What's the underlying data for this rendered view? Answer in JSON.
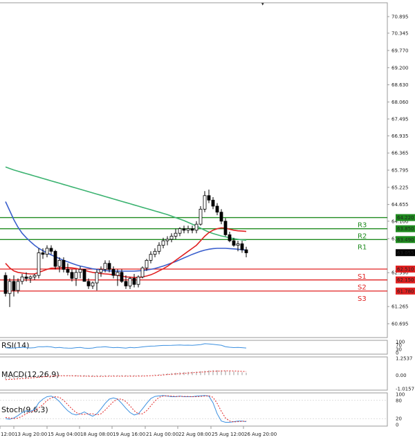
{
  "colors": {
    "background": "#ffffff",
    "panel_border": "#9a9a9a",
    "axis_text": "#222222",
    "bull_candle": "#ffffff",
    "bear_candle": "#000000",
    "ma_short": "#e02020",
    "ma_mid": "#3a5fcd",
    "ma_long": "#3cb371",
    "resistance": "#1e8a1e",
    "support": "#e02020",
    "price_tag": "#000000",
    "indicator_line": "#3a8fe0",
    "macd_signal": "#e02020",
    "macd_hist": "#9a9a9a",
    "stoch_signal": "#e02020"
  },
  "price_axis": {
    "ticks": [
      "70.895",
      "70.345",
      "69.770",
      "69.200",
      "68.630",
      "68.060",
      "67.495",
      "66.935",
      "66.365",
      "65.795",
      "65.225",
      "64.655",
      "64.100",
      "63.520",
      "62.390",
      "61.265",
      "60.695"
    ],
    "scale_min": 60.695,
    "scale_max": 70.895
  },
  "time_axis": {
    "labels": [
      "12:00",
      "13 Aug 20:00",
      "15 Aug 04:00",
      "18 Aug 08:00",
      "19 Aug 16:00",
      "21 Aug 00:00",
      "22 Aug 08:00",
      "25 Aug 12:00",
      "26 Aug 20:00"
    ]
  },
  "levels": [
    {
      "name": "R3",
      "tag": "64.220",
      "value": 64.22,
      "kind": "resistance"
    },
    {
      "name": "R2",
      "tag": "63.850",
      "value": 63.85,
      "kind": "resistance"
    },
    {
      "name": "R1",
      "tag": "63.490",
      "value": 63.49,
      "kind": "resistance"
    },
    {
      "name": "S1",
      "tag": "62.510",
      "value": 62.51,
      "kind": "support"
    },
    {
      "name": "S2",
      "tag": "62.150",
      "value": 62.15,
      "kind": "support"
    },
    {
      "name": "S3",
      "tag": "61.780",
      "value": 61.78,
      "kind": "support"
    }
  ],
  "current_price": {
    "tag": "63.055",
    "value": 63.055
  },
  "chart_data": {
    "type": "candlestick",
    "ylim": [
      60.695,
      70.895
    ],
    "candles": [
      [
        62.3,
        62.4,
        61.6,
        61.7
      ],
      [
        61.7,
        62.2,
        61.25,
        62.1
      ],
      [
        62.1,
        62.3,
        61.6,
        61.8
      ],
      [
        61.8,
        62.2,
        61.7,
        62.1
      ],
      [
        62.1,
        62.35,
        62.0,
        62.25
      ],
      [
        62.25,
        62.4,
        62.1,
        62.2
      ],
      [
        62.2,
        62.3,
        62.05,
        62.25
      ],
      [
        62.25,
        62.35,
        62.15,
        62.3
      ],
      [
        62.3,
        63.2,
        62.2,
        63.05
      ],
      [
        63.05,
        63.2,
        62.85,
        63.0
      ],
      [
        63.0,
        63.3,
        62.9,
        63.2
      ],
      [
        63.2,
        63.3,
        63.0,
        63.1
      ],
      [
        63.1,
        63.15,
        62.5,
        62.6
      ],
      [
        62.6,
        62.9,
        62.4,
        62.8
      ],
      [
        62.8,
        62.9,
        62.4,
        62.5
      ],
      [
        62.5,
        62.7,
        62.3,
        62.4
      ],
      [
        62.4,
        62.5,
        62.1,
        62.2
      ],
      [
        62.2,
        62.5,
        61.95,
        62.4
      ],
      [
        62.4,
        62.6,
        62.2,
        62.5
      ],
      [
        62.5,
        62.5,
        62.1,
        62.1
      ],
      [
        62.1,
        62.2,
        61.85,
        61.95
      ],
      [
        61.95,
        62.1,
        61.85,
        62.05
      ],
      [
        62.05,
        62.5,
        61.8,
        62.4
      ],
      [
        62.4,
        62.6,
        62.25,
        62.5
      ],
      [
        62.5,
        62.8,
        62.4,
        62.7
      ],
      [
        62.7,
        62.8,
        62.4,
        62.5
      ],
      [
        62.5,
        62.6,
        62.2,
        62.3
      ],
      [
        62.3,
        62.5,
        61.95,
        62.4
      ],
      [
        62.4,
        62.5,
        62.05,
        62.1
      ],
      [
        62.1,
        62.3,
        61.85,
        61.95
      ],
      [
        61.95,
        62.25,
        61.85,
        62.2
      ],
      [
        62.2,
        62.35,
        61.9,
        62.0
      ],
      [
        62.0,
        62.3,
        61.9,
        62.25
      ],
      [
        62.25,
        62.6,
        62.2,
        62.55
      ],
      [
        62.55,
        62.85,
        62.45,
        62.8
      ],
      [
        62.8,
        63.1,
        62.7,
        63.0
      ],
      [
        63.0,
        63.2,
        62.9,
        63.1
      ],
      [
        63.1,
        63.4,
        63.0,
        63.3
      ],
      [
        63.3,
        63.55,
        63.2,
        63.45
      ],
      [
        63.45,
        63.6,
        63.3,
        63.5
      ],
      [
        63.5,
        63.7,
        63.4,
        63.6
      ],
      [
        63.6,
        63.85,
        63.5,
        63.7
      ],
      [
        63.7,
        63.9,
        63.6,
        63.85
      ],
      [
        63.85,
        63.95,
        63.7,
        63.8
      ],
      [
        63.8,
        63.95,
        63.7,
        63.85
      ],
      [
        63.85,
        63.95,
        63.7,
        63.8
      ],
      [
        63.8,
        64.1,
        63.7,
        64.0
      ],
      [
        64.0,
        64.6,
        63.95,
        64.5
      ],
      [
        64.5,
        65.1,
        64.4,
        64.95
      ],
      [
        64.95,
        65.15,
        64.7,
        64.8
      ],
      [
        64.8,
        64.9,
        64.5,
        64.6
      ],
      [
        64.6,
        64.7,
        64.3,
        64.4
      ],
      [
        64.4,
        64.5,
        64.0,
        64.1
      ],
      [
        64.1,
        64.2,
        63.6,
        63.65
      ],
      [
        63.65,
        63.75,
        63.4,
        63.45
      ],
      [
        63.45,
        63.55,
        63.25,
        63.3
      ],
      [
        63.3,
        63.45,
        63.1,
        63.35
      ],
      [
        63.35,
        63.45,
        63.05,
        63.15
      ],
      [
        63.15,
        63.25,
        62.9,
        63.05
      ]
    ],
    "ma_short": [
      62.7,
      62.55,
      62.45,
      62.4,
      62.38,
      62.36,
      62.35,
      62.35,
      62.4,
      62.45,
      62.5,
      62.54,
      62.54,
      62.55,
      62.56,
      62.56,
      62.55,
      62.53,
      62.5,
      62.47,
      62.43,
      62.4,
      62.38,
      62.36,
      62.35,
      62.34,
      62.32,
      62.3,
      62.28,
      62.25,
      62.24,
      62.23,
      62.23,
      62.25,
      62.28,
      62.32,
      62.38,
      62.45,
      62.52,
      62.6,
      62.7,
      62.8,
      62.9,
      63.0,
      63.1,
      63.2,
      63.3,
      63.45,
      63.6,
      63.72,
      63.8,
      63.85,
      63.88,
      63.87,
      63.83,
      63.8,
      63.78,
      63.77,
      63.76
    ],
    "ma_mid": [
      64.75,
      64.45,
      64.15,
      63.9,
      63.7,
      63.55,
      63.42,
      63.3,
      63.2,
      63.12,
      63.05,
      62.98,
      62.92,
      62.86,
      62.8,
      62.75,
      62.7,
      62.65,
      62.61,
      62.58,
      62.55,
      62.52,
      62.5,
      62.48,
      62.46,
      62.45,
      62.44,
      62.44,
      62.44,
      62.44,
      62.44,
      62.44,
      62.45,
      62.46,
      62.48,
      62.5,
      62.53,
      62.57,
      62.61,
      62.66,
      62.71,
      62.76,
      62.82,
      62.88,
      62.94,
      63.0,
      63.05,
      63.1,
      63.14,
      63.17,
      63.19,
      63.2,
      63.2,
      63.2,
      63.19,
      63.18,
      63.17,
      63.15,
      63.14
    ],
    "ma_long": [
      65.9,
      65.85,
      65.8,
      65.76,
      65.72,
      65.68,
      65.64,
      65.6,
      65.56,
      65.52,
      65.48,
      65.44,
      65.4,
      65.36,
      65.32,
      65.28,
      65.24,
      65.2,
      65.16,
      65.12,
      65.08,
      65.04,
      65.0,
      64.96,
      64.92,
      64.88,
      64.84,
      64.8,
      64.76,
      64.72,
      64.68,
      64.64,
      64.6,
      64.56,
      64.52,
      64.48,
      64.44,
      64.4,
      64.36,
      64.32,
      64.27,
      64.22,
      64.17,
      64.12,
      64.06,
      64.0,
      63.94,
      63.87,
      63.8,
      63.74,
      63.69,
      63.65,
      63.61,
      63.58,
      63.55,
      63.52,
      63.5,
      63.48,
      63.47
    ],
    "rsi": {
      "label": "RSI(14)",
      "ticks": [
        "100",
        "70",
        "30",
        "0"
      ],
      "ylim": [
        0,
        100
      ],
      "values": [
        45,
        42,
        44,
        47,
        48,
        46,
        44,
        46,
        55,
        54,
        56,
        53,
        45,
        48,
        44,
        42,
        41,
        46,
        48,
        42,
        40,
        43,
        50,
        52,
        55,
        50,
        46,
        48,
        45,
        42,
        48,
        45,
        48,
        53,
        57,
        60,
        61,
        64,
        66,
        66,
        67,
        69,
        70,
        68,
        69,
        67,
        70,
        74,
        82,
        80,
        76,
        72,
        68,
        55,
        50,
        47,
        49,
        46,
        43
      ]
    },
    "macd": {
      "label": "MACD(12,26,9)",
      "ticks": [
        "1.2537",
        "0.00",
        "-1.0157"
      ],
      "ylim": [
        -1.0157,
        1.2537
      ],
      "histogram": [
        -0.3,
        -0.28,
        -0.26,
        -0.24,
        -0.21,
        -0.18,
        -0.15,
        -0.12,
        -0.08,
        -0.05,
        -0.03,
        -0.02,
        -0.02,
        -0.03,
        -0.04,
        -0.05,
        -0.06,
        -0.08,
        -0.09,
        -0.1,
        -0.11,
        -0.11,
        -0.1,
        -0.09,
        -0.08,
        -0.07,
        -0.07,
        -0.07,
        -0.08,
        -0.08,
        -0.08,
        -0.07,
        -0.06,
        -0.04,
        -0.02,
        0.01,
        0.04,
        0.07,
        0.1,
        0.13,
        0.16,
        0.18,
        0.21,
        0.23,
        0.24,
        0.25,
        0.26,
        0.29,
        0.33,
        0.36,
        0.37,
        0.37,
        0.36,
        0.33,
        0.3,
        0.27,
        0.24,
        0.21,
        0.18
      ],
      "signal": [
        -0.34,
        -0.32,
        -0.3,
        -0.28,
        -0.26,
        -0.24,
        -0.21,
        -0.19,
        -0.16,
        -0.13,
        -0.1,
        -0.08,
        -0.06,
        -0.05,
        -0.05,
        -0.05,
        -0.05,
        -0.06,
        -0.07,
        -0.07,
        -0.08,
        -0.09,
        -0.09,
        -0.09,
        -0.09,
        -0.08,
        -0.08,
        -0.08,
        -0.08,
        -0.08,
        -0.08,
        -0.08,
        -0.07,
        -0.07,
        -0.06,
        -0.04,
        -0.03,
        -0.01,
        0.01,
        0.04,
        0.06,
        0.09,
        0.11,
        0.13,
        0.16,
        0.18,
        0.2,
        0.22,
        0.24,
        0.27,
        0.29,
        0.3,
        0.31,
        0.32,
        0.32,
        0.31,
        0.3,
        0.28,
        0.27
      ]
    },
    "stoch": {
      "label": "Stoch(9,6,3)",
      "ticks": [
        "100",
        "80",
        "20",
        "0"
      ],
      "ylim": [
        0,
        100
      ],
      "k": [
        20,
        18,
        22,
        30,
        40,
        46,
        44,
        50,
        72,
        84,
        92,
        94,
        88,
        76,
        60,
        46,
        36,
        32,
        36,
        42,
        34,
        28,
        36,
        52,
        70,
        84,
        88,
        84,
        70,
        54,
        40,
        32,
        36,
        52,
        70,
        86,
        93,
        95,
        96,
        94,
        92,
        92,
        94,
        92,
        92,
        92,
        94,
        95,
        96,
        94,
        72,
        36,
        12,
        8,
        8,
        10,
        12,
        12,
        10
      ],
      "d": [
        24,
        22,
        20,
        22,
        28,
        36,
        42,
        46,
        55,
        66,
        80,
        88,
        92,
        90,
        80,
        66,
        52,
        40,
        34,
        34,
        36,
        36,
        32,
        36,
        48,
        62,
        76,
        84,
        84,
        76,
        62,
        46,
        36,
        36,
        46,
        62,
        78,
        90,
        94,
        95,
        94,
        93,
        93,
        93,
        93,
        92,
        92,
        93,
        94,
        95,
        90,
        70,
        44,
        22,
        12,
        9,
        10,
        11,
        12
      ]
    }
  }
}
